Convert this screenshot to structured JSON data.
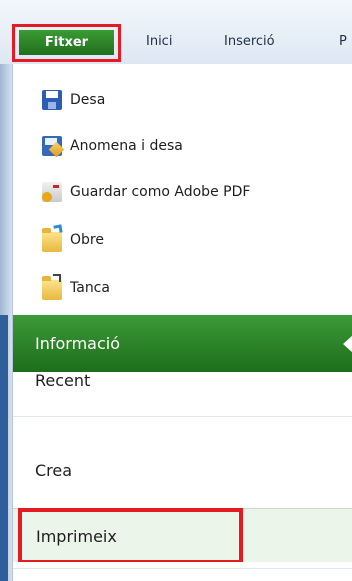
{
  "ribbon": {
    "tabs": [
      {
        "label": "Fitxer"
      },
      {
        "label": "Inici"
      },
      {
        "label": "Inserció"
      },
      {
        "label": "P"
      }
    ]
  },
  "commands": [
    {
      "label": "Desa",
      "icon": "save-icon"
    },
    {
      "label": "Anomena i desa",
      "icon": "save-as-icon"
    },
    {
      "label": "Guardar como Adobe PDF",
      "icon": "pdf-icon"
    },
    {
      "label": "Obre",
      "icon": "open-folder-icon"
    },
    {
      "label": "Tanca",
      "icon": "close-folder-icon"
    }
  ],
  "nav": {
    "selected": "Informació",
    "items": [
      {
        "label": "Recent"
      },
      {
        "label": "Crea"
      },
      {
        "label": "Imprimeix"
      }
    ]
  },
  "colors": {
    "accent_green": "#2e8a2b",
    "highlight_red": "#e51b23"
  }
}
